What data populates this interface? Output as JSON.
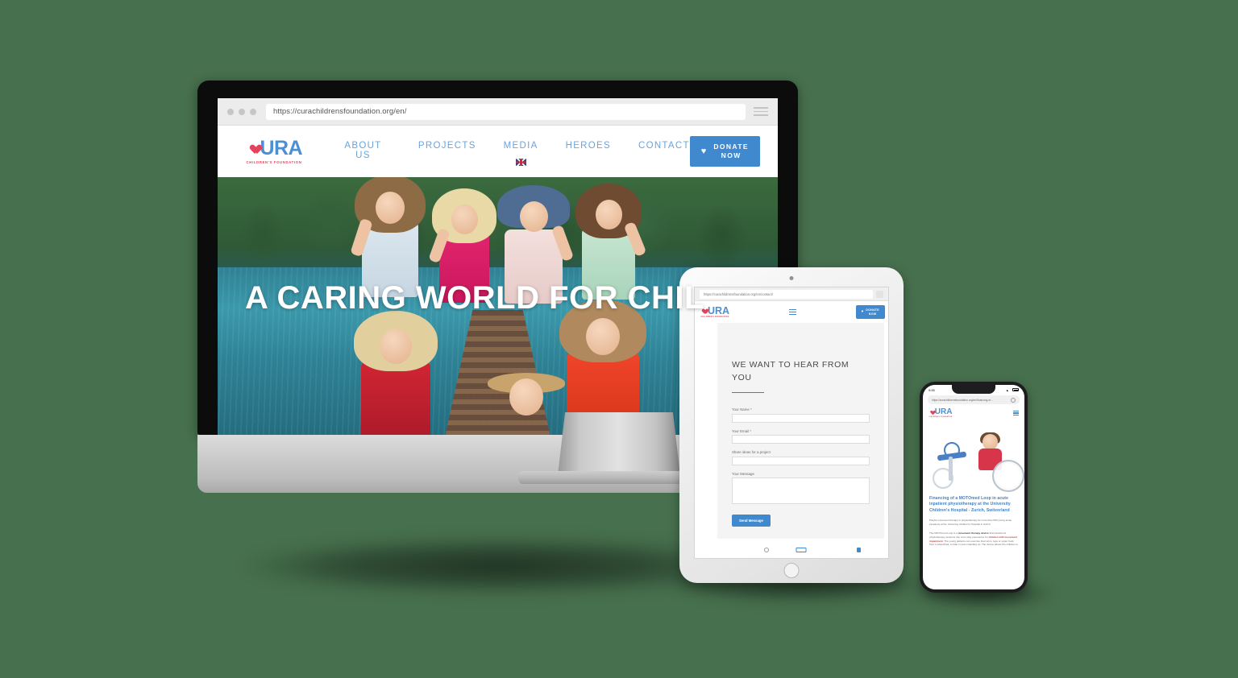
{
  "background_color": "#47704E",
  "desktop": {
    "browser": {
      "url": "https://curachildrensfoundation.org/en/"
    },
    "site": {
      "logo": {
        "word": "URA",
        "tagline": "CHILDREN'S FOUNDATION"
      },
      "nav": [
        {
          "label": "ABOUT US"
        },
        {
          "label": "PROJECTS"
        },
        {
          "label": "MEDIA"
        },
        {
          "label": "HEROES"
        },
        {
          "label": "CONTACT"
        }
      ],
      "language_flag": "uk-flag-icon",
      "donate": {
        "icon": "heart-icon",
        "line1": "DONATE",
        "line2": "NOW"
      },
      "hero": {
        "title": "A CARING WORLD FOR CHIL",
        "image_alt": "children waving on a lake dock"
      }
    }
  },
  "tablet": {
    "browser": {
      "url": "https://curachildrensfoundation.org/en/contact/"
    },
    "site": {
      "logo": {
        "word": "URA",
        "tagline": "CHILDREN'S FOUNDATION"
      },
      "menu_icon": "hamburger-icon",
      "donate": {
        "icon": "heart-icon",
        "line1": "DONATE",
        "line2": "NOW"
      },
      "form": {
        "heading": "WE WANT TO HEAR FROM YOU",
        "fields": [
          {
            "label": "Your Name",
            "required": "*",
            "value": "",
            "type": "input"
          },
          {
            "label": "Your Email",
            "required": "*",
            "value": "",
            "type": "input"
          },
          {
            "label": "Share ideas for a project",
            "required": "",
            "value": "",
            "type": "input"
          },
          {
            "label": "Your Message",
            "required": "",
            "value": "",
            "type": "textarea"
          }
        ],
        "submit_label": "Send Message"
      }
    }
  },
  "phone": {
    "status": {
      "time": "9:55",
      "wifi_icon": "wifi-icon",
      "battery_icon": "battery-icon"
    },
    "browser": {
      "url": "https://curachildrensfoundation.org/en/financing-of...",
      "reload_icon": "reload-icon"
    },
    "site": {
      "logo": {
        "word": "URA",
        "tagline": "CHILDREN'S FOUNDATION"
      },
      "menu_icon": "hamburger-icon",
      "article": {
        "title": "Financing of a MOTOmed Loop in acute inpatient physiotherapy at the University Children's Hospital - Zurich, Switzerland",
        "paragraph1": "Playful movement therapy in physiotherapy for more than 500 young acute inpatients at the University Children's Hospital in Zurich.",
        "paragraph2_part1": "The MOTOmed Loop is a ",
        "paragraph2_bold1": "movement therapy device",
        "paragraph2_part2": " that transforms physiotherapy sessions into a fun play experience for ",
        "paragraph2_highlight": "children with movement impairment",
        "paragraph2_part3": ". The young patients can exercise their arms, legs or upper body from a wheelchair, a chair or even standing up. The device allows the children to"
      }
    }
  }
}
